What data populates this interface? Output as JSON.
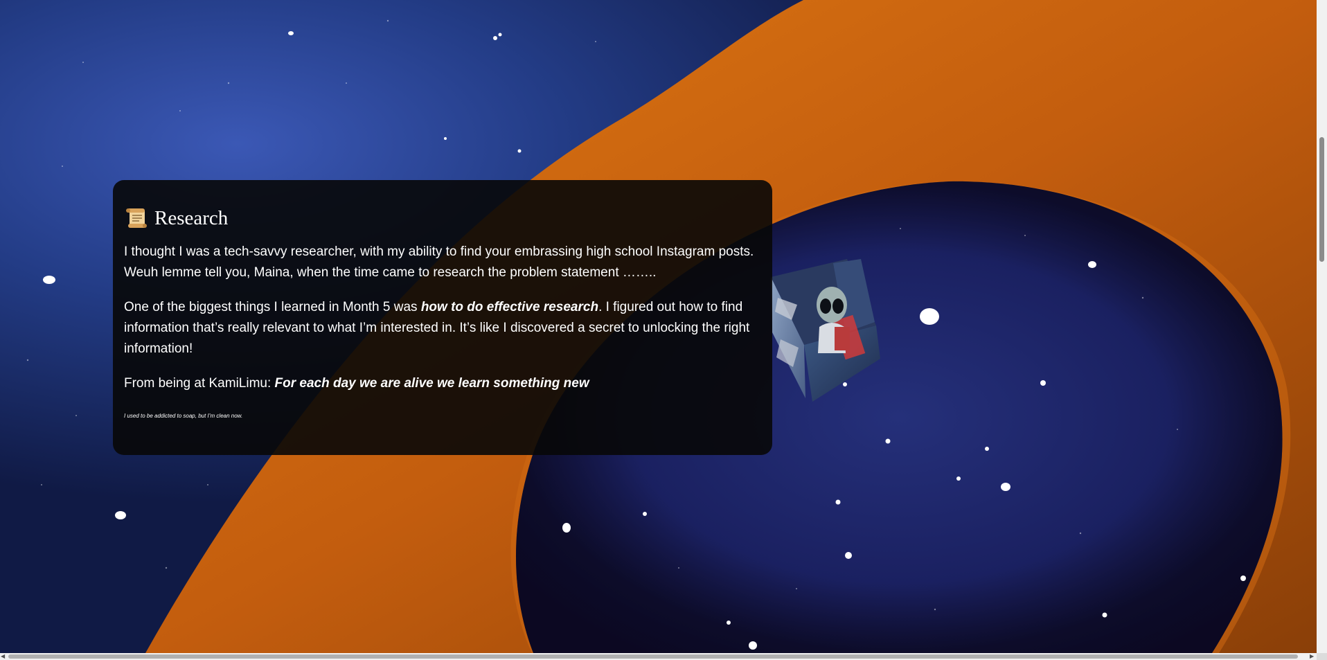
{
  "section": {
    "title": "Research",
    "title_icon": "scroll-icon",
    "paragraphs": {
      "p1": "I thought I was a tech-savvy researcher, with my ability to find your embrassing high school Instagram posts. Weuh lemme tell you, Maina, when the time came to research the problem statement ……..",
      "p2_before": "One of the biggest things I learned in Month 5 was ",
      "p2_emphasis": "how to do effective research",
      "p2_after": ". I figured out how to find information that’s really relevant to what I’m interested in. It’s like I discovered a secret to unlocking the right information!",
      "p3_before": "From being at KamiLimu: ",
      "p3_emphasis": "For each day we are alive we learn something new"
    },
    "footnote": "I used to be addicted to soap, but I’m clean now."
  },
  "decor": {
    "cube_icon": "alien-cube-icon",
    "background": "starfield-with-orange-ribbon"
  },
  "colors": {
    "space_dark": "#0d1537",
    "space_blue": "#27428f",
    "ribbon_orange": "#c9620f",
    "card_bg": "#0a0a0a",
    "text": "#ffffff"
  }
}
